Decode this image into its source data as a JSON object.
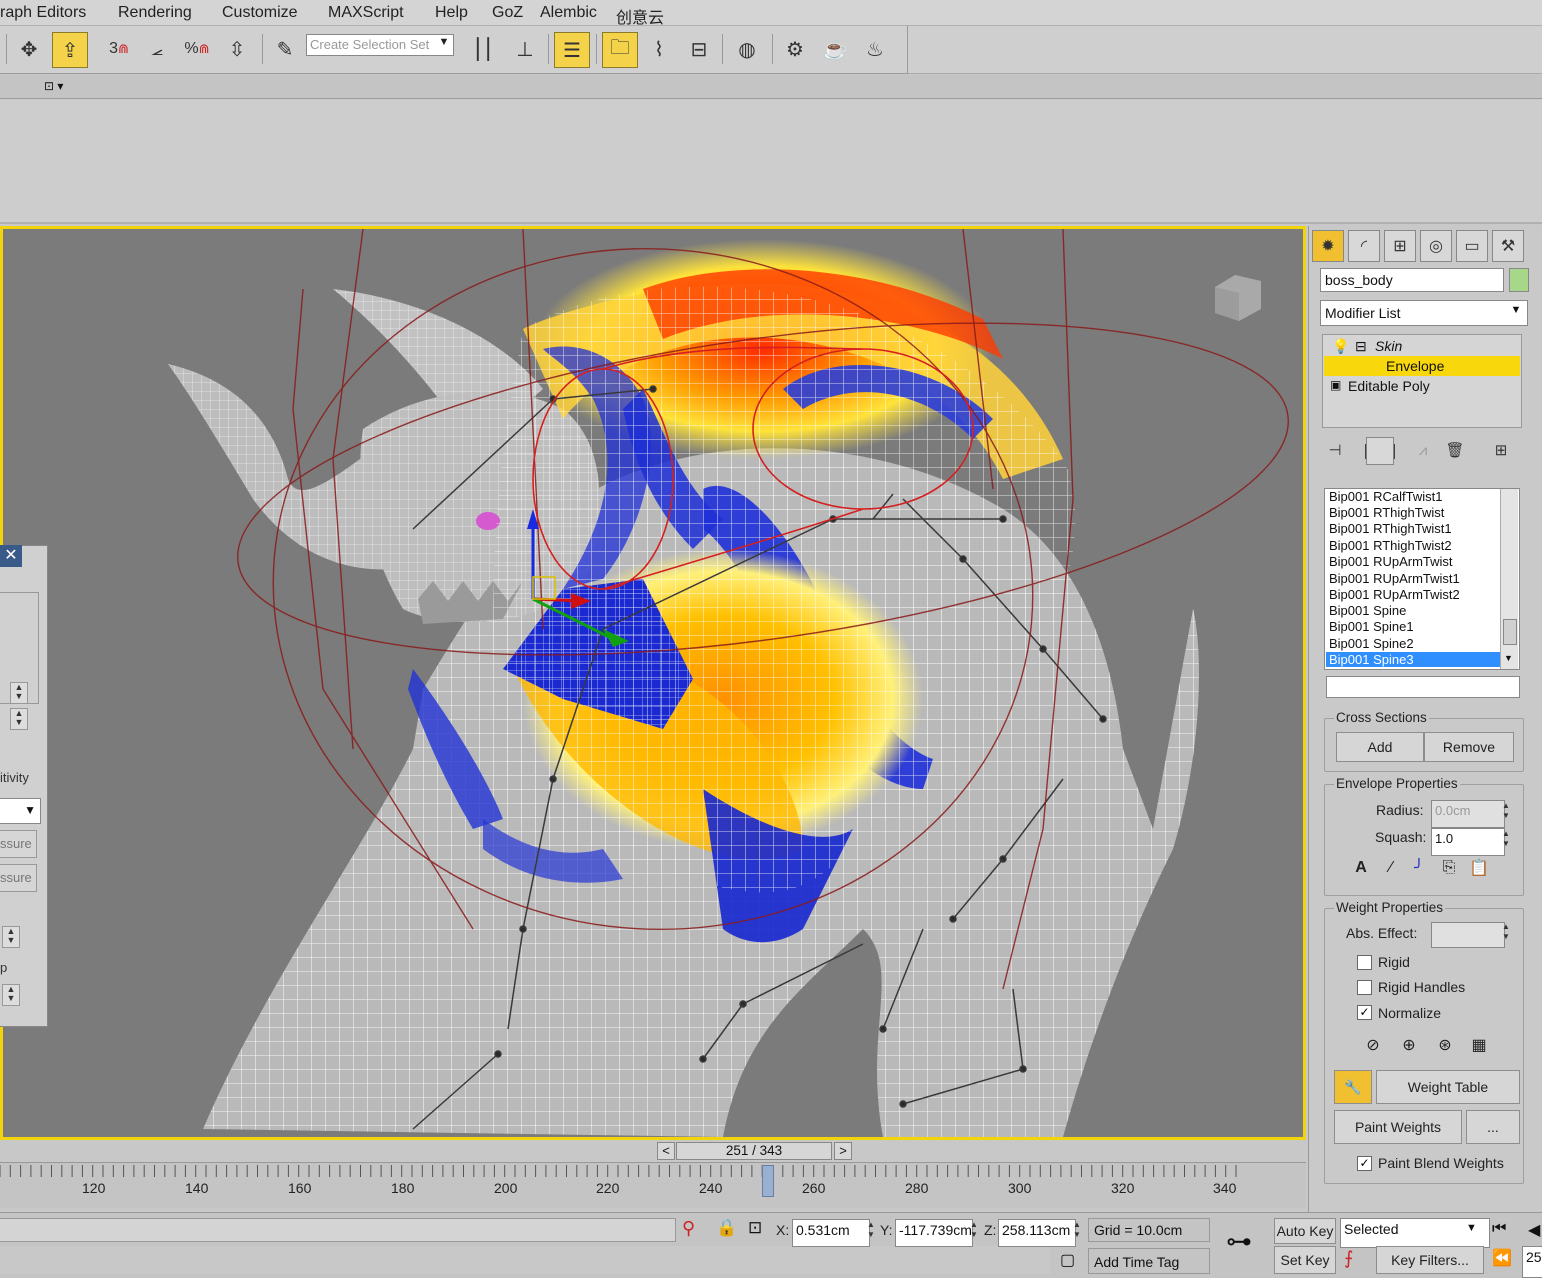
{
  "menu": {
    "items": [
      "raph Editors",
      "Rendering",
      "Customize",
      "MAXScript",
      "Help",
      "GoZ",
      "Alembic",
      "创意云"
    ]
  },
  "toolbar": {
    "selection_set_placeholder": "Create Selection Set"
  },
  "command_panel": {
    "object_name": "boss_body",
    "object_color": "#a7d88a",
    "modifier_list_label": "Modifier List",
    "stack": {
      "skin": "Skin",
      "envelope": "Envelope",
      "editable_poly": "Editable Poly"
    },
    "bones": [
      "Bip001 RCalfTwist1",
      "Bip001 RThighTwist",
      "Bip001 RThighTwist1",
      "Bip001 RThighTwist2",
      "Bip001 RUpArmTwist",
      "Bip001 RUpArmTwist1",
      "Bip001 RUpArmTwist2",
      "Bip001 Spine",
      "Bip001 Spine1",
      "Bip001 Spine2",
      "Bip001 Spine3"
    ],
    "selected_bone": "Bip001 Spine3",
    "cross_sections": {
      "title": "Cross Sections",
      "add": "Add",
      "remove": "Remove"
    },
    "envelope_properties": {
      "title": "Envelope Properties",
      "radius_label": "Radius:",
      "radius_value": "0.0cm",
      "squash_label": "Squash:",
      "squash_value": "1.0"
    },
    "weight_properties": {
      "title": "Weight Properties",
      "abs_effect_label": "Abs. Effect:",
      "abs_effect_value": "",
      "rigid": "Rigid",
      "rigid_checked": false,
      "rigid_handles": "Rigid Handles",
      "rigid_handles_checked": false,
      "normalize": "Normalize",
      "normalize_checked": true,
      "weight_table": "Weight Table",
      "paint_weights": "Paint Weights",
      "paint_options": "...",
      "paint_blend_weights": "Paint Blend Weights",
      "paint_blend_checked": true
    }
  },
  "floating_panel": {
    "text1": "itivity",
    "text2": "ssure",
    "text3": "ssure",
    "text4": "p"
  },
  "timeline": {
    "frame_display": "251 / 343",
    "prev": "<",
    "next": ">",
    "current_frame": 251,
    "total_frames": 343,
    "ticks": [
      "120",
      "140",
      "160",
      "180",
      "200",
      "220",
      "240",
      "260",
      "280",
      "300",
      "320",
      "340"
    ]
  },
  "status": {
    "x_label": "X:",
    "x_value": "0.531cm",
    "y_label": "Y:",
    "y_value": "-117.739cm",
    "z_label": "Z:",
    "z_value": "258.113cm",
    "grid": "Grid = 10.0cm",
    "add_time_tag": "Add Time Tag",
    "auto_key": "Auto Key",
    "set_key": "Set Key",
    "selected": "Selected",
    "key_filters": "Key Filters...",
    "frame_partial": "25"
  },
  "colors": {
    "viewport_border": "#f2d40a",
    "active_button": "#f4d34a",
    "selected_bone": "#2f8fff",
    "viewport_bg": "#7b7b7b"
  }
}
